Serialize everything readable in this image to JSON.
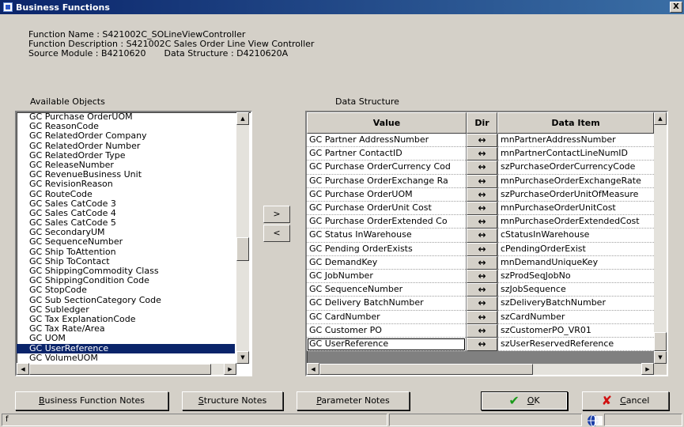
{
  "window": {
    "title": "Business Functions",
    "close_label": "X"
  },
  "info": {
    "function_name": "Function Name : S421002C_SOLineViewController",
    "function_description": "Function Description : S421002C Sales Order Line View Controller",
    "source_module": "Source Module : B4210620",
    "data_structure": "Data Structure : D4210620A"
  },
  "available_objects": {
    "label": "Available Objects",
    "items": [
      "GC Purchase OrderUOM",
      "GC ReasonCode",
      "GC RelatedOrder Company",
      "GC RelatedOrder Number",
      "GC RelatedOrder Type",
      "GC ReleaseNumber",
      "GC RevenueBusiness Unit",
      "GC RevisionReason",
      "GC RouteCode",
      "GC Sales CatCode 3",
      "GC Sales CatCode 4",
      "GC Sales CatCode 5",
      "GC SecondaryUM",
      "GC SequenceNumber",
      "GC Ship ToAttention",
      "GC Ship ToContact",
      "GC ShippingCommodity Class",
      "GC ShippingCondition Code",
      "GC StopCode",
      "GC Sub SectionCategory Code",
      "GC Subledger",
      "GC Tax ExplanationCode",
      "GC Tax Rate/Area",
      "GC UOM",
      "GC UserReference",
      "GC VolumeUOM"
    ],
    "selected_index": 24
  },
  "move_buttons": {
    "add": ">",
    "remove": "<"
  },
  "data_structure": {
    "label": "Data Structure",
    "columns": {
      "value": "Value",
      "dir": "Dir",
      "data_item": "Data Item"
    },
    "dir_symbol": "↔",
    "rows": [
      {
        "value": "GC Partner AddressNumber",
        "data_item": "mnPartnerAddressNumber"
      },
      {
        "value": "GC Partner ContactID",
        "data_item": "mnPartnerContactLineNumID"
      },
      {
        "value": "GC Purchase OrderCurrency Cod",
        "data_item": "szPurchaseOrderCurrencyCode"
      },
      {
        "value": "GC Purchase OrderExchange Ra",
        "data_item": "mnPurchaseOrderExchangeRate"
      },
      {
        "value": "GC Purchase OrderUOM",
        "data_item": "szPurchaseOrderUnitOfMeasure"
      },
      {
        "value": "GC Purchase OrderUnit Cost",
        "data_item": "mnPurchaseOrderUnitCost"
      },
      {
        "value": "GC Purchase OrderExtended Co",
        "data_item": "mnPurchaseOrderExtendedCost"
      },
      {
        "value": "GC Status InWarehouse",
        "data_item": "cStatusInWarehouse"
      },
      {
        "value": "GC Pending OrderExists",
        "data_item": "cPendingOrderExist"
      },
      {
        "value": "GC DemandKey",
        "data_item": "mnDemandUniqueKey"
      },
      {
        "value": "GC JobNumber",
        "data_item": "szProdSeqJobNo"
      },
      {
        "value": "GC SequenceNumber",
        "data_item": "szJobSequence"
      },
      {
        "value": "GC Delivery BatchNumber",
        "data_item": "szDeliveryBatchNumber"
      },
      {
        "value": "GC CardNumber",
        "data_item": "szCardNumber"
      },
      {
        "value": "GC Customer PO",
        "data_item": "szCustomerPO_VR01"
      },
      {
        "value": "GC UserReference",
        "data_item": "szUserReservedReference"
      }
    ],
    "focused_row": 15
  },
  "buttons": {
    "bf_notes": {
      "u": "B",
      "rest": "usiness Function Notes"
    },
    "structure_notes": {
      "u": "S",
      "rest": "tructure Notes"
    },
    "parameter_notes": {
      "u": "P",
      "rest": "arameter Notes"
    },
    "ok": {
      "u": "O",
      "rest": "K"
    },
    "cancel": {
      "u": "C",
      "rest": "ancel"
    }
  },
  "status": {
    "left_text": "f"
  },
  "colors": {
    "selection": "#0a246a",
    "ok_icon": "#1a9a1a",
    "cancel_icon": "#d01010"
  }
}
